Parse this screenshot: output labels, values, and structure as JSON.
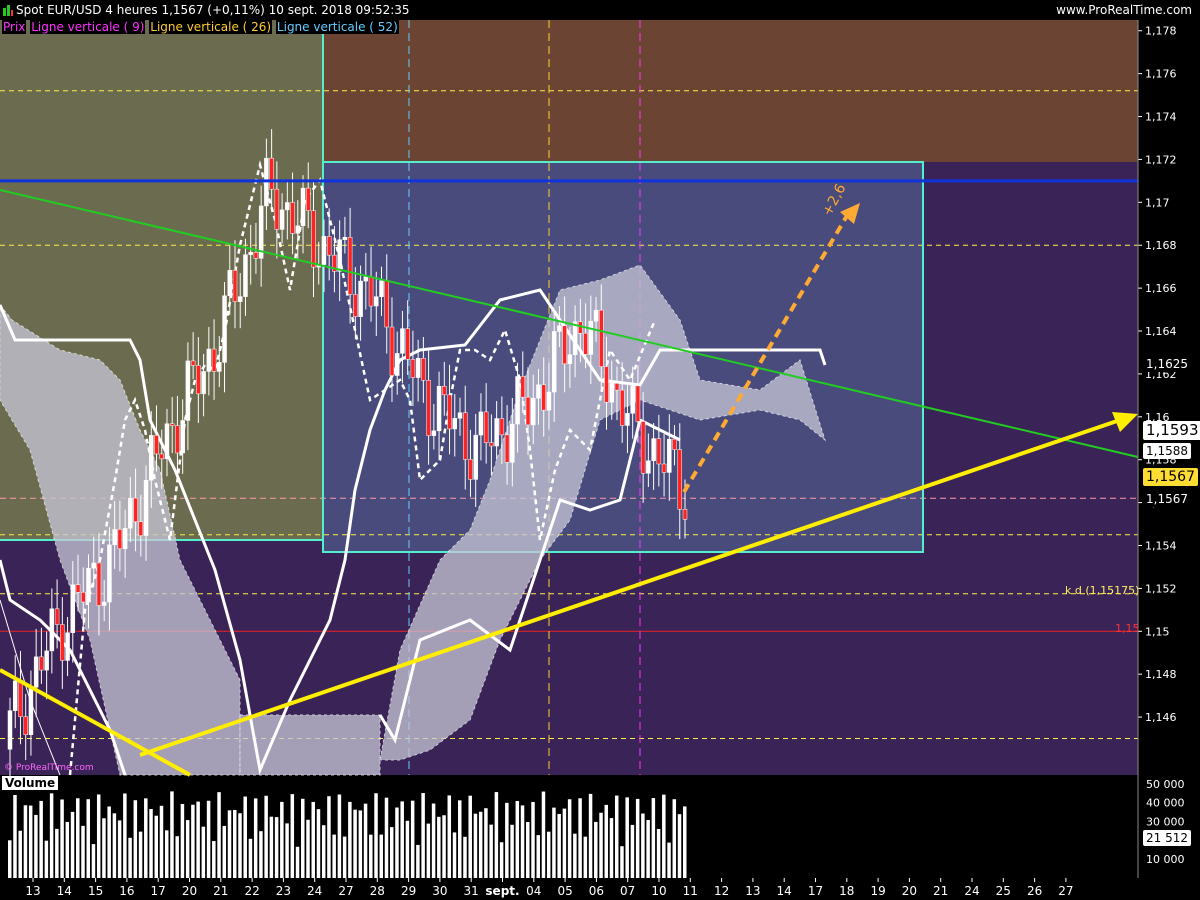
{
  "header": {
    "title": "Spot EUR/USD   4 heures   1,1567 (+0,11%)   10 sept. 2018 09:52:35",
    "site": "www.ProRealTime.com"
  },
  "legend": [
    {
      "label": "Prix",
      "color": "#ff33ff"
    },
    {
      "label": "Ligne verticale ( 9)",
      "color": "#ff33ff"
    },
    {
      "label": "Ligne verticale ( 26)",
      "color": "#ffcc33"
    },
    {
      "label": "Ligne verticale ( 52)",
      "color": "#66ccff"
    }
  ],
  "colors": {
    "plot_bg": "#3a2356",
    "zone_green": "#6b6b50",
    "zone_brown": "#6b4434",
    "zone_blue_box": "#4a5080",
    "box_border": "#55eecc",
    "cloud": "#c8c8d8",
    "up_candle": "#ffffff",
    "down_candle": "#ff2222",
    "resistance_line": "#1133dd",
    "green_trend": "#22cc22",
    "yellow_trend": "#ffee00",
    "projection": "#ffaa33"
  },
  "chart_data": {
    "type": "candlestick",
    "symbol": "Spot EUR/USD",
    "timeframe": "4 heures",
    "ylim": [
      1.1433,
      1.1785
    ],
    "y_ticks": [
      "1,178",
      "1,176",
      "1,174",
      "1,172",
      "1,17",
      "1,168",
      "1,166",
      "1,164",
      "1,162",
      "1,16",
      "1,158",
      "1,156",
      "1,154",
      "1,152",
      "1,15",
      "1,148",
      "1,146"
    ],
    "x_labels": [
      "13",
      "14",
      "15",
      "16",
      "17",
      "20",
      "21",
      "22",
      "23",
      "24",
      "27",
      "28",
      "29",
      "30",
      "31",
      "sept.",
      "04",
      "05",
      "06",
      "07",
      "10",
      "11",
      "12",
      "13",
      "14",
      "17",
      "18",
      "19",
      "20",
      "21",
      "24",
      "25",
      "26",
      "27"
    ],
    "price_tags": [
      {
        "label": "1,1625",
        "value": 1.1625,
        "style": "white"
      },
      {
        "label": "1,1593",
        "value": 1.1593,
        "style": "bigwhite"
      },
      {
        "label": "1,1588",
        "value": 1.1588,
        "style": "white"
      },
      {
        "label": "1,1567",
        "value": 1.1567,
        "style": "yellow"
      },
      {
        "label": "1,1567",
        "value": 1.1567,
        "style": "plain"
      }
    ],
    "annotations": [
      {
        "text": "k d (1,15175)",
        "value": 1.15175,
        "color": "#ffee66"
      },
      {
        "text": "1,15",
        "value": 1.15,
        "color": "#ff3333"
      },
      {
        "text": "+2,6",
        "color": "#ffaa33"
      }
    ],
    "levels": {
      "resistance": 1.171,
      "dashed_yellow": [
        1.1752,
        1.168,
        1.1545,
        1.15175,
        1.145
      ],
      "dashed_pink": 1.1562,
      "red_solid": 1.15
    },
    "candles_close_sample": [
      1.1455,
      1.1505,
      1.1535,
      1.159,
      1.1635,
      1.1705,
      1.168,
      1.1655,
      1.161,
      1.1585,
      1.1605,
      1.1645,
      1.1595,
      1.1567
    ],
    "volume": {
      "label": "Volume",
      "ylim": [
        0,
        52000
      ],
      "y_ticks": [
        "50 000",
        "40 000",
        "30 000",
        "10 000"
      ],
      "current": "21 512"
    }
  }
}
